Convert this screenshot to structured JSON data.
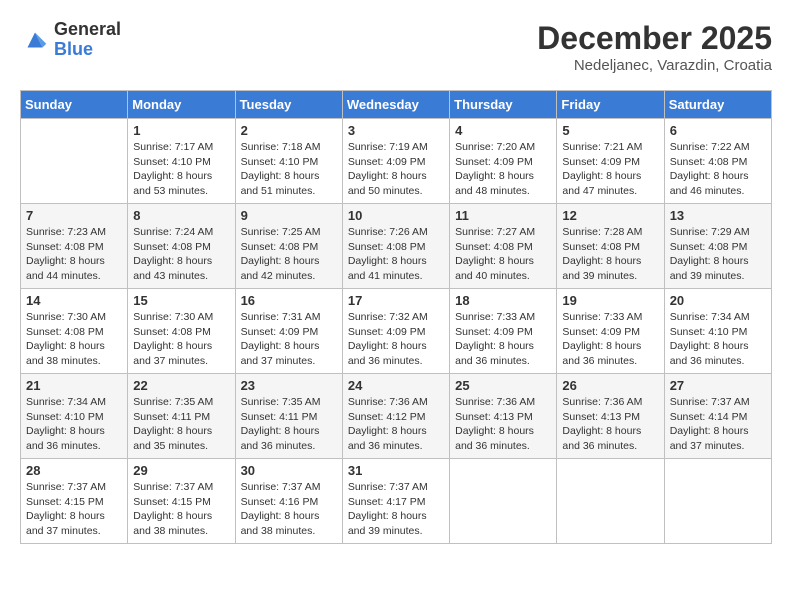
{
  "logo": {
    "general": "General",
    "blue": "Blue"
  },
  "title": {
    "month": "December 2025",
    "location": "Nedeljanec, Varazdin, Croatia"
  },
  "weekdays": [
    "Sunday",
    "Monday",
    "Tuesday",
    "Wednesday",
    "Thursday",
    "Friday",
    "Saturday"
  ],
  "weeks": [
    [
      {
        "day": "",
        "sunrise": "",
        "sunset": "",
        "daylight": ""
      },
      {
        "day": "1",
        "sunrise": "Sunrise: 7:17 AM",
        "sunset": "Sunset: 4:10 PM",
        "daylight": "Daylight: 8 hours and 53 minutes."
      },
      {
        "day": "2",
        "sunrise": "Sunrise: 7:18 AM",
        "sunset": "Sunset: 4:10 PM",
        "daylight": "Daylight: 8 hours and 51 minutes."
      },
      {
        "day": "3",
        "sunrise": "Sunrise: 7:19 AM",
        "sunset": "Sunset: 4:09 PM",
        "daylight": "Daylight: 8 hours and 50 minutes."
      },
      {
        "day": "4",
        "sunrise": "Sunrise: 7:20 AM",
        "sunset": "Sunset: 4:09 PM",
        "daylight": "Daylight: 8 hours and 48 minutes."
      },
      {
        "day": "5",
        "sunrise": "Sunrise: 7:21 AM",
        "sunset": "Sunset: 4:09 PM",
        "daylight": "Daylight: 8 hours and 47 minutes."
      },
      {
        "day": "6",
        "sunrise": "Sunrise: 7:22 AM",
        "sunset": "Sunset: 4:08 PM",
        "daylight": "Daylight: 8 hours and 46 minutes."
      }
    ],
    [
      {
        "day": "7",
        "sunrise": "Sunrise: 7:23 AM",
        "sunset": "Sunset: 4:08 PM",
        "daylight": "Daylight: 8 hours and 44 minutes."
      },
      {
        "day": "8",
        "sunrise": "Sunrise: 7:24 AM",
        "sunset": "Sunset: 4:08 PM",
        "daylight": "Daylight: 8 hours and 43 minutes."
      },
      {
        "day": "9",
        "sunrise": "Sunrise: 7:25 AM",
        "sunset": "Sunset: 4:08 PM",
        "daylight": "Daylight: 8 hours and 42 minutes."
      },
      {
        "day": "10",
        "sunrise": "Sunrise: 7:26 AM",
        "sunset": "Sunset: 4:08 PM",
        "daylight": "Daylight: 8 hours and 41 minutes."
      },
      {
        "day": "11",
        "sunrise": "Sunrise: 7:27 AM",
        "sunset": "Sunset: 4:08 PM",
        "daylight": "Daylight: 8 hours and 40 minutes."
      },
      {
        "day": "12",
        "sunrise": "Sunrise: 7:28 AM",
        "sunset": "Sunset: 4:08 PM",
        "daylight": "Daylight: 8 hours and 39 minutes."
      },
      {
        "day": "13",
        "sunrise": "Sunrise: 7:29 AM",
        "sunset": "Sunset: 4:08 PM",
        "daylight": "Daylight: 8 hours and 39 minutes."
      }
    ],
    [
      {
        "day": "14",
        "sunrise": "Sunrise: 7:30 AM",
        "sunset": "Sunset: 4:08 PM",
        "daylight": "Daylight: 8 hours and 38 minutes."
      },
      {
        "day": "15",
        "sunrise": "Sunrise: 7:30 AM",
        "sunset": "Sunset: 4:08 PM",
        "daylight": "Daylight: 8 hours and 37 minutes."
      },
      {
        "day": "16",
        "sunrise": "Sunrise: 7:31 AM",
        "sunset": "Sunset: 4:09 PM",
        "daylight": "Daylight: 8 hours and 37 minutes."
      },
      {
        "day": "17",
        "sunrise": "Sunrise: 7:32 AM",
        "sunset": "Sunset: 4:09 PM",
        "daylight": "Daylight: 8 hours and 36 minutes."
      },
      {
        "day": "18",
        "sunrise": "Sunrise: 7:33 AM",
        "sunset": "Sunset: 4:09 PM",
        "daylight": "Daylight: 8 hours and 36 minutes."
      },
      {
        "day": "19",
        "sunrise": "Sunrise: 7:33 AM",
        "sunset": "Sunset: 4:09 PM",
        "daylight": "Daylight: 8 hours and 36 minutes."
      },
      {
        "day": "20",
        "sunrise": "Sunrise: 7:34 AM",
        "sunset": "Sunset: 4:10 PM",
        "daylight": "Daylight: 8 hours and 36 minutes."
      }
    ],
    [
      {
        "day": "21",
        "sunrise": "Sunrise: 7:34 AM",
        "sunset": "Sunset: 4:10 PM",
        "daylight": "Daylight: 8 hours and 36 minutes."
      },
      {
        "day": "22",
        "sunrise": "Sunrise: 7:35 AM",
        "sunset": "Sunset: 4:11 PM",
        "daylight": "Daylight: 8 hours and 35 minutes."
      },
      {
        "day": "23",
        "sunrise": "Sunrise: 7:35 AM",
        "sunset": "Sunset: 4:11 PM",
        "daylight": "Daylight: 8 hours and 36 minutes."
      },
      {
        "day": "24",
        "sunrise": "Sunrise: 7:36 AM",
        "sunset": "Sunset: 4:12 PM",
        "daylight": "Daylight: 8 hours and 36 minutes."
      },
      {
        "day": "25",
        "sunrise": "Sunrise: 7:36 AM",
        "sunset": "Sunset: 4:13 PM",
        "daylight": "Daylight: 8 hours and 36 minutes."
      },
      {
        "day": "26",
        "sunrise": "Sunrise: 7:36 AM",
        "sunset": "Sunset: 4:13 PM",
        "daylight": "Daylight: 8 hours and 36 minutes."
      },
      {
        "day": "27",
        "sunrise": "Sunrise: 7:37 AM",
        "sunset": "Sunset: 4:14 PM",
        "daylight": "Daylight: 8 hours and 37 minutes."
      }
    ],
    [
      {
        "day": "28",
        "sunrise": "Sunrise: 7:37 AM",
        "sunset": "Sunset: 4:15 PM",
        "daylight": "Daylight: 8 hours and 37 minutes."
      },
      {
        "day": "29",
        "sunrise": "Sunrise: 7:37 AM",
        "sunset": "Sunset: 4:15 PM",
        "daylight": "Daylight: 8 hours and 38 minutes."
      },
      {
        "day": "30",
        "sunrise": "Sunrise: 7:37 AM",
        "sunset": "Sunset: 4:16 PM",
        "daylight": "Daylight: 8 hours and 38 minutes."
      },
      {
        "day": "31",
        "sunrise": "Sunrise: 7:37 AM",
        "sunset": "Sunset: 4:17 PM",
        "daylight": "Daylight: 8 hours and 39 minutes."
      },
      {
        "day": "",
        "sunrise": "",
        "sunset": "",
        "daylight": ""
      },
      {
        "day": "",
        "sunrise": "",
        "sunset": "",
        "daylight": ""
      },
      {
        "day": "",
        "sunrise": "",
        "sunset": "",
        "daylight": ""
      }
    ]
  ]
}
